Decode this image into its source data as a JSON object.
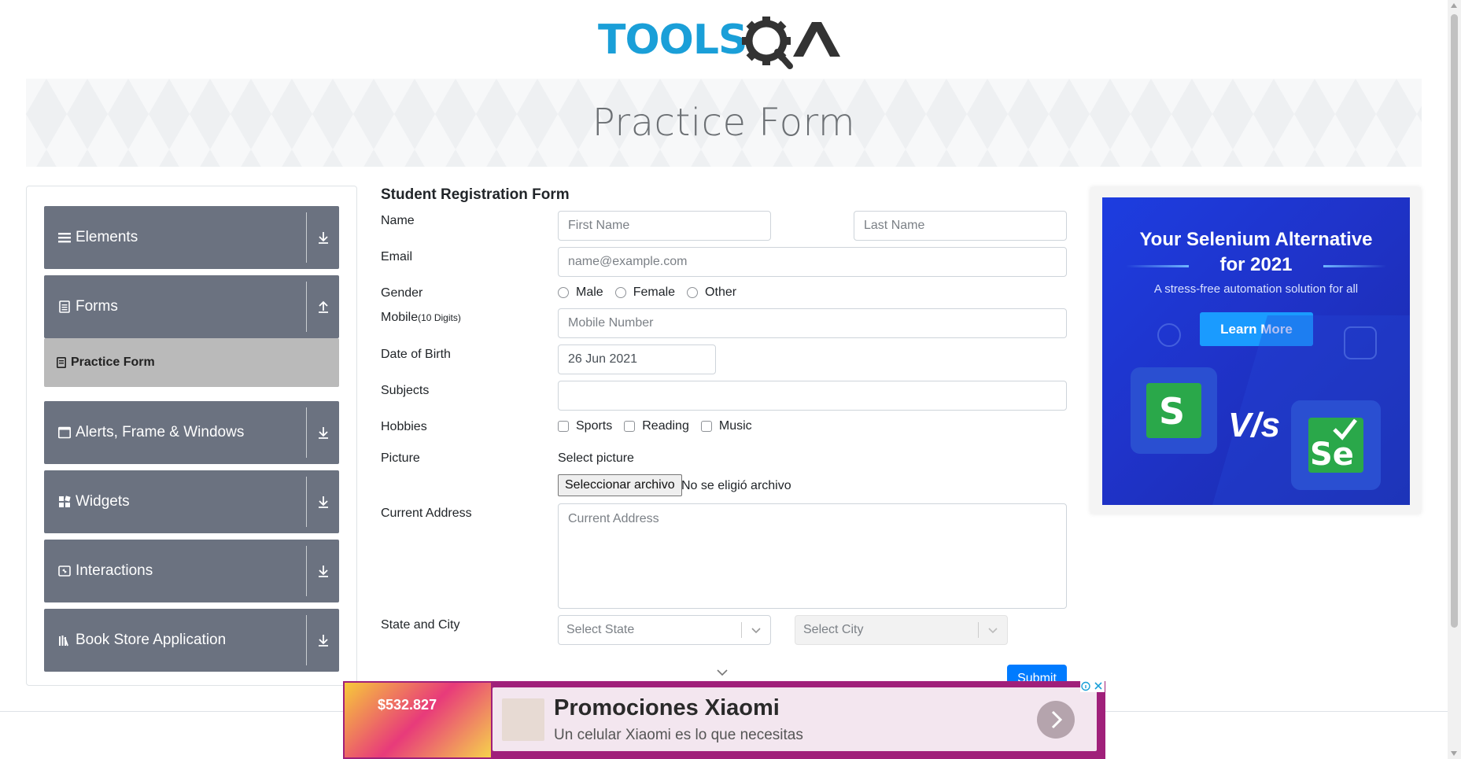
{
  "header": {
    "logo_text_tools": "TOOLS",
    "logo_text_qa": "QA",
    "page_title": "Practice Form"
  },
  "sidebar": {
    "groups": [
      {
        "label": "Elements",
        "icon": "hamburger-icon",
        "arrow": "download-arrow-icon"
      },
      {
        "label": "Forms",
        "icon": "document-icon",
        "arrow": "upload-arrow-icon"
      },
      {
        "label": "Alerts, Frame & Windows",
        "icon": "window-icon",
        "arrow": "download-arrow-icon"
      },
      {
        "label": "Widgets",
        "icon": "widgets-icon",
        "arrow": "download-arrow-icon"
      },
      {
        "label": "Interactions",
        "icon": "interactions-icon",
        "arrow": "download-arrow-icon"
      },
      {
        "label": "Book Store Application",
        "icon": "books-icon",
        "arrow": "download-arrow-icon"
      }
    ],
    "active_item": "Practice Form"
  },
  "form": {
    "title": "Student Registration Form",
    "labels": {
      "name": "Name",
      "email": "Email",
      "gender": "Gender",
      "mobile": "Mobile",
      "mobile_hint": "(10 Digits)",
      "dob": "Date of Birth",
      "subjects": "Subjects",
      "hobbies": "Hobbies",
      "picture": "Picture",
      "address": "Current Address",
      "state_city": "State and City"
    },
    "placeholders": {
      "first_name": "First Name",
      "last_name": "Last Name",
      "email": "name@example.com",
      "mobile": "Mobile Number",
      "address": "Current Address"
    },
    "dob_value": "26 Jun 2021",
    "genders": [
      "Male",
      "Female",
      "Other"
    ],
    "hobbies": [
      "Sports",
      "Reading",
      "Music"
    ],
    "picture_label": "Select picture",
    "file_button": "Seleccionar archivo",
    "file_status": "No se eligió archivo",
    "state_placeholder": "Select State",
    "city_placeholder": "Select City",
    "submit": "Submit"
  },
  "ad_right": {
    "headline_1": "Your Selenium Alternative",
    "headline_2": "for 2021",
    "sub": "A stress-free automation solution for all",
    "button": "Learn More",
    "vs": "V/s",
    "logo_left": "S",
    "logo_right": "Se"
  },
  "ad_bottom": {
    "title": "Promociones Xiaomi",
    "description": "Un celular Xiaomi es lo que necesitas",
    "price": "$532.827"
  },
  "colors": {
    "sidebar_header": "#6b7280",
    "sidebar_active": "#bababa",
    "primary": "#007bff",
    "logo_blue": "#1a9fd8",
    "logo_dark": "#333333",
    "ad_blue": "#1f33c9",
    "ad_magenta": "#a0207a"
  }
}
